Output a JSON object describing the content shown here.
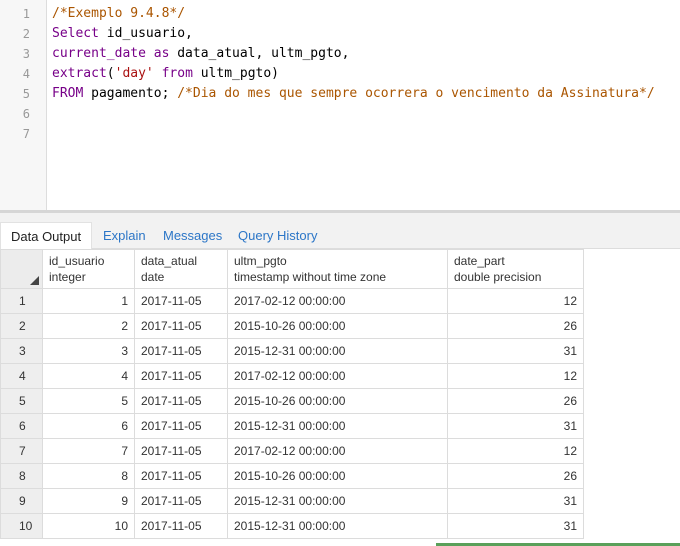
{
  "editor": {
    "line_numbers": [
      "1",
      "2",
      "3",
      "4",
      "5",
      "6",
      "7"
    ],
    "lines": [
      [
        {
          "t": "/*Exemplo 9.4.8*/",
          "c": "cmt"
        }
      ],
      [
        {
          "t": "Select",
          "c": "kw"
        },
        {
          "t": " id_usuario,",
          "c": ""
        }
      ],
      [
        {
          "t": "current_date",
          "c": "kw"
        },
        {
          "t": " ",
          "c": ""
        },
        {
          "t": "as",
          "c": "kw"
        },
        {
          "t": " data_atual, ultm_pgto,",
          "c": ""
        }
      ],
      [
        {
          "t": "extract",
          "c": "kw"
        },
        {
          "t": "(",
          "c": ""
        },
        {
          "t": "'day'",
          "c": "str"
        },
        {
          "t": " ",
          "c": ""
        },
        {
          "t": "from",
          "c": "kw"
        },
        {
          "t": " ultm_pgto)",
          "c": ""
        }
      ],
      [
        {
          "t": "FROM",
          "c": "kw"
        },
        {
          "t": " pagamento; ",
          "c": ""
        },
        {
          "t": "/*Dia do mes que sempre ocorrera o vencimento da Assinatura*/",
          "c": "cmt"
        }
      ],
      [],
      []
    ]
  },
  "tabs": [
    {
      "label": "Data Output",
      "active": true
    },
    {
      "label": "Explain",
      "active": false
    },
    {
      "label": "Messages",
      "active": false
    },
    {
      "label": "Query History",
      "active": false
    }
  ],
  "grid": {
    "columns": [
      {
        "name": "id_usuario",
        "type": "integer"
      },
      {
        "name": "data_atual",
        "type": "date"
      },
      {
        "name": "ultm_pgto",
        "type": "timestamp without time zone"
      },
      {
        "name": "date_part",
        "type": "double precision"
      }
    ],
    "rows": [
      [
        "1",
        "1",
        "2017-11-05",
        "2017-02-12 00:00:00",
        "12"
      ],
      [
        "2",
        "2",
        "2017-11-05",
        "2015-10-26 00:00:00",
        "26"
      ],
      [
        "3",
        "3",
        "2017-11-05",
        "2015-12-31 00:00:00",
        "31"
      ],
      [
        "4",
        "4",
        "2017-11-05",
        "2017-02-12 00:00:00",
        "12"
      ],
      [
        "5",
        "5",
        "2017-11-05",
        "2015-10-26 00:00:00",
        "26"
      ],
      [
        "6",
        "6",
        "2017-11-05",
        "2015-12-31 00:00:00",
        "31"
      ],
      [
        "7",
        "7",
        "2017-11-05",
        "2017-02-12 00:00:00",
        "12"
      ],
      [
        "8",
        "8",
        "2017-11-05",
        "2015-10-26 00:00:00",
        "26"
      ],
      [
        "9",
        "9",
        "2017-11-05",
        "2015-12-31 00:00:00",
        "31"
      ],
      [
        "10",
        "10",
        "2017-11-05",
        "2015-12-31 00:00:00",
        "31"
      ]
    ]
  },
  "colors": {
    "accent": "#2c76c7",
    "keyword": "#770088",
    "comment": "#aa5500",
    "string": "#aa1111"
  }
}
